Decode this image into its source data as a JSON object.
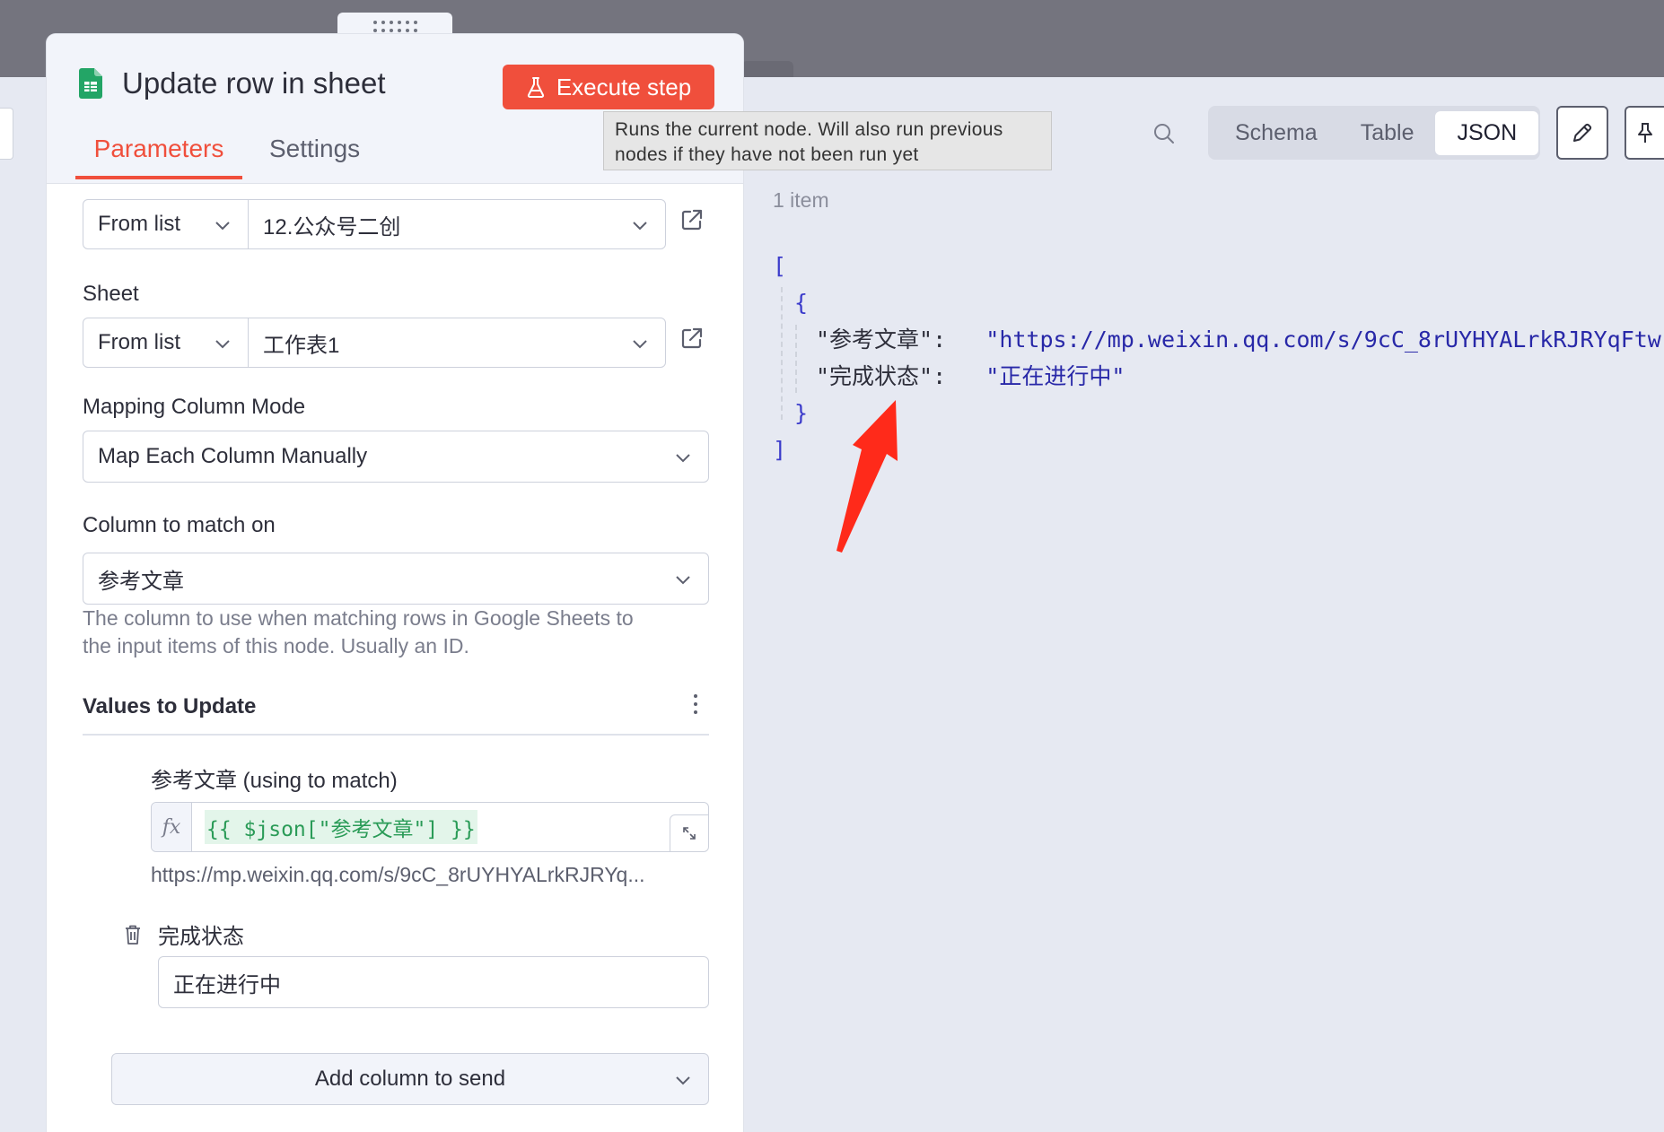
{
  "node": {
    "title": "Update row in sheet",
    "execute_label": "Execute step",
    "tabs": [
      "Parameters",
      "Settings"
    ],
    "active_tab": "Parameters"
  },
  "tooltip": {
    "line1": "Runs the current node. Will also run previous",
    "line2": "nodes if they have not been run yet"
  },
  "params": {
    "document": {
      "mode": "From list",
      "value": "12.公众号二创"
    },
    "sheet": {
      "label": "Sheet",
      "mode": "From list",
      "value": "工作表1"
    },
    "mapping_mode": {
      "label": "Mapping Column Mode",
      "value": "Map Each Column Manually"
    },
    "match_column": {
      "label": "Column to match on",
      "value": "参考文章",
      "hint_line1": "The column to use when matching rows in Google Sheets to",
      "hint_line2": "the input items of this node. Usually an ID."
    },
    "values_to_update": {
      "title": "Values to Update",
      "field1": {
        "label": "参考文章 (using to match)",
        "fx": "fx",
        "expression": "{{ $json[\"参考文章\"] }}",
        "result": "https://mp.weixin.qq.com/s/9cC_8rUYHYALrkRJRYq..."
      },
      "field2": {
        "label": "完成状态",
        "value": "正在进行中"
      },
      "add_column_label": "Add column to send"
    }
  },
  "output": {
    "views": [
      "Schema",
      "Table",
      "JSON"
    ],
    "active_view": "JSON",
    "item_count": "1 item",
    "json": {
      "open_bracket": "[",
      "open_brace": "{",
      "key1": "\"参考文章\":",
      "value1": "\"https://mp.weixin.qq.com/s/9cC_8rUYHYALrkRJRYqFtw\",",
      "key2": "\"完成状态\":",
      "value2": "\"正在进行中\"",
      "close_brace": "}",
      "close_bracket": "]"
    }
  },
  "colors": {
    "accent": "#f04f3c",
    "annotation_arrow": "#ff2a1a",
    "expression_green": "#2a9b57",
    "topbar": "#74747e"
  },
  "icons": [
    "google-sheets-icon",
    "flask-icon",
    "external-link-icon",
    "chevron-down-icon",
    "trash-icon",
    "search-icon",
    "pencil-icon",
    "pin-icon",
    "expand-icon"
  ]
}
